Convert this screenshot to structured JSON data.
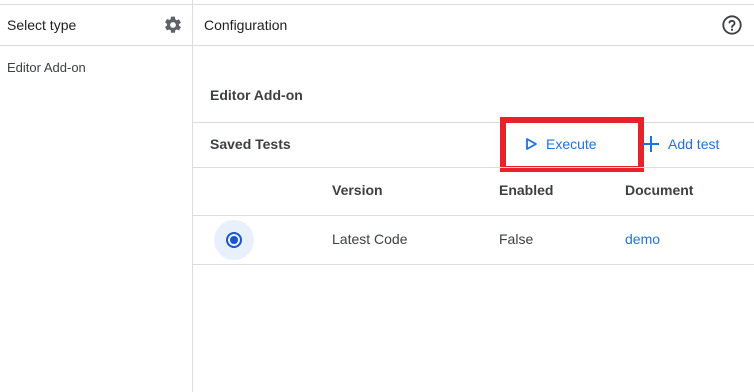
{
  "left_panel": {
    "title": "Select type",
    "items": [
      {
        "label": "Editor Add-on"
      }
    ]
  },
  "right_panel": {
    "title": "Configuration",
    "section_title": "Editor Add-on",
    "saved_tests_label": "Saved Tests",
    "execute_label": "Execute",
    "add_test_label": "Add test",
    "table": {
      "headers": [
        "Version",
        "Enabled",
        "Document"
      ],
      "rows": [
        {
          "version": "Latest Code",
          "enabled": "False",
          "document": "demo",
          "selected": true
        }
      ]
    }
  },
  "colors": {
    "accent": "#1a73e8",
    "highlight": "#e8222b",
    "divider": "#dadce0"
  },
  "icons": [
    "gear-icon",
    "help-icon",
    "play-icon",
    "plus-icon",
    "radio-selected-icon"
  ]
}
